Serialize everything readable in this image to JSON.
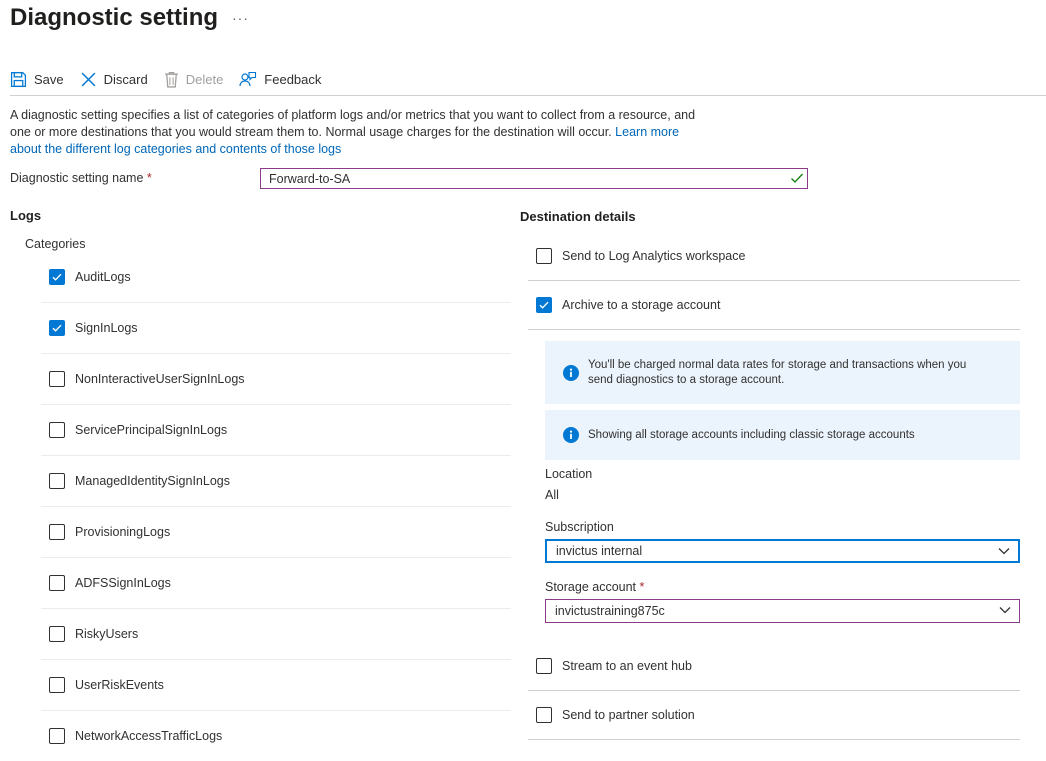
{
  "header": {
    "title": "Diagnostic setting",
    "more_label": "···"
  },
  "toolbar": {
    "save": "Save",
    "discard": "Discard",
    "delete": "Delete",
    "feedback": "Feedback"
  },
  "description": {
    "text": "A diagnostic setting specifies a list of categories of platform logs and/or metrics that you want to collect from a resource, and one or more destinations that you would stream them to. Normal usage charges for the destination will occur. ",
    "link": "Learn more about the different log categories and contents of those logs"
  },
  "setting_name": {
    "label": "Diagnostic setting name",
    "required_mark": "*",
    "value": "Forward-to-SA"
  },
  "logs": {
    "heading": "Logs",
    "categories_heading": "Categories",
    "categories": [
      {
        "label": "AuditLogs",
        "checked": true
      },
      {
        "label": "SignInLogs",
        "checked": true
      },
      {
        "label": "NonInteractiveUserSignInLogs",
        "checked": false
      },
      {
        "label": "ServicePrincipalSignInLogs",
        "checked": false
      },
      {
        "label": "ManagedIdentitySignInLogs",
        "checked": false
      },
      {
        "label": "ProvisioningLogs",
        "checked": false
      },
      {
        "label": "ADFSSignInLogs",
        "checked": false
      },
      {
        "label": "RiskyUsers",
        "checked": false
      },
      {
        "label": "UserRiskEvents",
        "checked": false
      },
      {
        "label": "NetworkAccessTrafficLogs",
        "checked": false
      }
    ]
  },
  "destination": {
    "heading": "Destination details",
    "log_analytics": {
      "label": "Send to Log Analytics workspace",
      "checked": false
    },
    "storage": {
      "label": "Archive to a storage account",
      "checked": true
    },
    "info_charges": "You'll be charged normal data rates for storage and transactions when you send diagnostics to a storage account.",
    "info_classic": "Showing all storage accounts including classic storage accounts",
    "location": {
      "label": "Location",
      "value": "All"
    },
    "subscription": {
      "label": "Subscription",
      "value": "invictus internal"
    },
    "storage_account": {
      "label": "Storage account",
      "required_mark": "*",
      "value": "invictustraining875c"
    },
    "event_hub": {
      "label": "Stream to an event hub",
      "checked": false
    },
    "partner": {
      "label": "Send to partner solution",
      "checked": false
    }
  },
  "colors": {
    "accent": "#0078d4",
    "focus_border": "#8a3c8b",
    "link": "#0067b8",
    "info_bg": "#ebf3fc",
    "required": "#a4262c",
    "valid": "#107c10"
  }
}
